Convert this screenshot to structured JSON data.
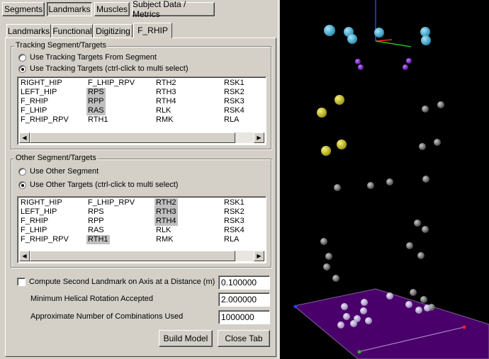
{
  "top_tabs": [
    "Segments",
    "Landmarks",
    "Muscles",
    "Subject Data / Metrics"
  ],
  "sub_tabs": [
    "Landmarks",
    "Functional",
    "Digitizing",
    "F_RHIP"
  ],
  "tracking_group": {
    "title": "Tracking Segment/Targets",
    "option_from_segment": "Use Tracking Targets From Segment",
    "option_targets": "Use Tracking Targets (ctrl-click to multi select)",
    "items": [
      [
        "RIGHT_HIP",
        "LEFT_HIP",
        "F_RHIP",
        "F_LHIP",
        "F_RHIP_RPV"
      ],
      [
        "F_LHIP_RPV",
        "RPS",
        "RPP",
        "RAS",
        "RTH1"
      ],
      [
        "RTH2",
        "RTH3",
        "RTH4",
        "RLK",
        "RMK"
      ],
      [
        "RSK1",
        "RSK2",
        "RSK3",
        "RSK4",
        "RLA"
      ]
    ]
  },
  "other_group": {
    "title": "Other Segment/Targets",
    "option_segment": "Use Other Segment",
    "option_targets": "Use Other Targets (ctrl-click to multi select)",
    "items": [
      [
        "RIGHT_HIP",
        "LEFT_HIP",
        "F_RHIP",
        "F_LHIP",
        "F_RHIP_RPV"
      ],
      [
        "F_LHIP_RPV",
        "RPS",
        "RPP",
        "RAS",
        "RTH1"
      ],
      [
        "RTH2",
        "RTH3",
        "RTH4",
        "RLK",
        "RMK"
      ],
      [
        "RSK1",
        "RSK2",
        "RSK3",
        "RSK4",
        "RLA"
      ]
    ]
  },
  "settings": {
    "second_landmark_label": "Compute Second Landmark on Axis at a Distance (m)",
    "second_landmark_value": "0.100000",
    "helical_label": "Minimum Helical Rotation Accepted",
    "helical_value": "2.000000",
    "combinations_label": "Approximate Number of Combinations Used",
    "combinations_value": "1000000"
  },
  "buttons": {
    "build_model": "Build Model",
    "close_tab": "Close Tab"
  },
  "colors": {
    "marker_cyan": "#4fb3d9",
    "marker_yellow": "#c8c020",
    "marker_purple": "#7a1fc0",
    "marker_gray": "#8a8a8a",
    "floor": "#4a006a"
  }
}
